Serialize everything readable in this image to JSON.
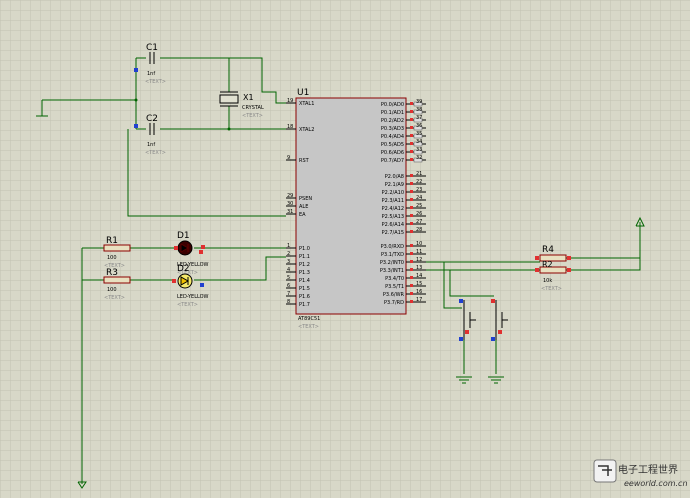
{
  "schematic": {
    "components": {
      "c1": {
        "ref": "C1",
        "value": "1nf",
        "text": "<TEXT>"
      },
      "c2": {
        "ref": "C2",
        "value": "1nf",
        "text": "<TEXT>"
      },
      "x1": {
        "ref": "X1",
        "value": "CRYSTAL",
        "text": "<TEXT>"
      },
      "u1": {
        "ref": "U1",
        "part": "AT89C51",
        "text": "<TEXT>"
      },
      "d1": {
        "ref": "D1",
        "value": "LED-YELLOW",
        "text": "<TEXT>"
      },
      "d2": {
        "ref": "D2",
        "value": "LED-YELLOW",
        "text": "<TEXT>"
      },
      "r1": {
        "ref": "R1",
        "value": "100",
        "text": "<TEXT>"
      },
      "r3": {
        "ref": "R3",
        "value": "100",
        "text": "<TEXT>"
      },
      "r4": {
        "ref": "R4",
        "value": "10k",
        "text": "<TEXT>"
      },
      "r2": {
        "ref": "R2",
        "value": "10k",
        "text": "<TEXT>"
      }
    },
    "u1_left_pins": [
      {
        "num": "19",
        "name": "XTAL1"
      },
      {
        "num": "18",
        "name": "XTAL2"
      },
      {
        "num": "9",
        "name": "RST"
      },
      {
        "num": "29",
        "name": "PSEN"
      },
      {
        "num": "30",
        "name": "ALE"
      },
      {
        "num": "31",
        "name": "EA"
      },
      {
        "num": "1",
        "name": "P1.0"
      },
      {
        "num": "2",
        "name": "P1.1"
      },
      {
        "num": "3",
        "name": "P1.2"
      },
      {
        "num": "4",
        "name": "P1.3"
      },
      {
        "num": "5",
        "name": "P1.4"
      },
      {
        "num": "6",
        "name": "P1.5"
      },
      {
        "num": "7",
        "name": "P1.6"
      },
      {
        "num": "8",
        "name": "P1.7"
      }
    ],
    "u1_right_pins": [
      {
        "num": "39",
        "name": "P0.0/AD0"
      },
      {
        "num": "38",
        "name": "P0.1/AD1"
      },
      {
        "num": "37",
        "name": "P0.2/AD2"
      },
      {
        "num": "36",
        "name": "P0.3/AD3"
      },
      {
        "num": "35",
        "name": "P0.4/AD4"
      },
      {
        "num": "34",
        "name": "P0.5/AD5"
      },
      {
        "num": "33",
        "name": "P0.6/AD6"
      },
      {
        "num": "32",
        "name": "P0.7/AD7"
      },
      {
        "num": "21",
        "name": "P2.0/A8"
      },
      {
        "num": "22",
        "name": "P2.1/A9"
      },
      {
        "num": "23",
        "name": "P2.2/A10"
      },
      {
        "num": "24",
        "name": "P2.3/A11"
      },
      {
        "num": "25",
        "name": "P2.4/A12"
      },
      {
        "num": "26",
        "name": "P2.5/A13"
      },
      {
        "num": "27",
        "name": "P2.6/A14"
      },
      {
        "num": "28",
        "name": "P2.7/A15"
      },
      {
        "num": "10",
        "name": "P3.0/RXD"
      },
      {
        "num": "11",
        "name": "P3.1/TXD"
      },
      {
        "num": "12",
        "name": "P3.2/INT0"
      },
      {
        "num": "13",
        "name": "P3.3/INT1"
      },
      {
        "num": "14",
        "name": "P3.4/T0"
      },
      {
        "num": "15",
        "name": "P3.5/T1"
      },
      {
        "num": "16",
        "name": "P3.6/WR"
      },
      {
        "num": "17",
        "name": "P3.7/RD"
      }
    ],
    "watermark": {
      "text_cn": "电子工程世界",
      "text_en": "eeworld.com.cn"
    },
    "colors": {
      "background": "#d8d8c8",
      "grid": "#c4c4b4",
      "wire": "#006400",
      "body": "#c8c8c8",
      "outline": "#8b0000"
    }
  }
}
